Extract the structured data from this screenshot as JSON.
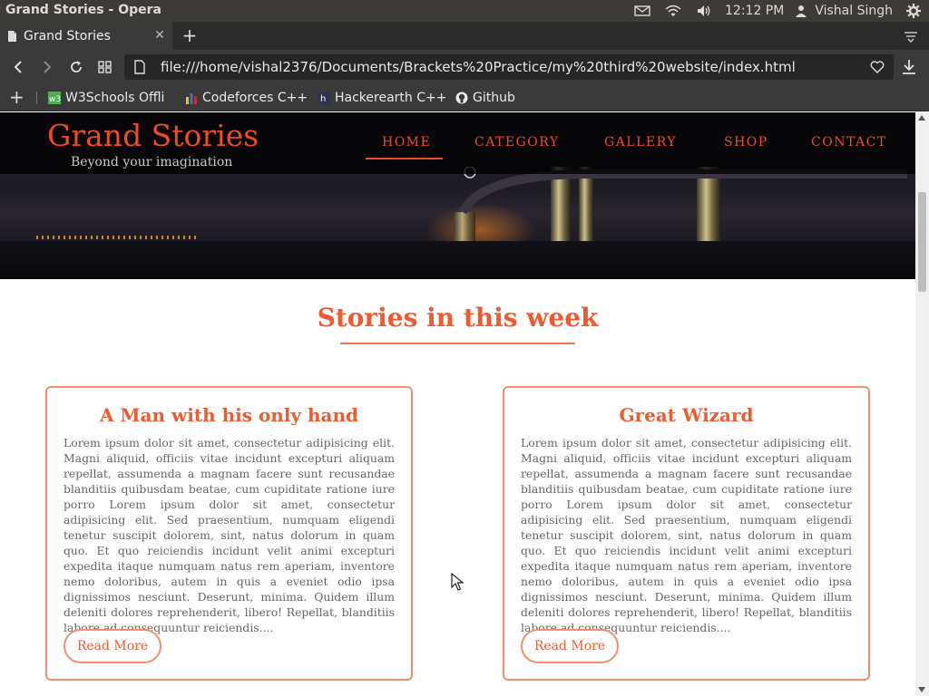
{
  "os": {
    "window_title": "Grand Stories - Opera",
    "time": "12:12 PM",
    "user": "Vishal Singh",
    "icons": [
      "mail-icon",
      "wifi-icon",
      "volume-icon",
      "user-icon",
      "settings-gear-icon"
    ]
  },
  "browser": {
    "tab_title": "Grand Stories",
    "url": "file:///home/vishal2376/Documents/Brackets%20Practice/my%20third%20website/index.html",
    "bookmarks": [
      {
        "label": "W3Schools Offli",
        "icon": "w3schools-icon"
      },
      {
        "label": "Codeforces C++",
        "icon": "codeforces-icon"
      },
      {
        "label": "Hackerearth C++",
        "icon": "hackerearth-icon"
      },
      {
        "label": "Github",
        "icon": "github-icon"
      }
    ]
  },
  "site": {
    "brand": "Grand Stories",
    "tagline": "Beyond your imagination",
    "nav": [
      "HOME",
      "CATEGORY",
      "GALLERY",
      "SHOP",
      "CONTACT"
    ],
    "active_nav": "HOME",
    "section_title": "Stories in this week",
    "accent_color": "#ef5a2e",
    "cards": [
      {
        "title": "A Man with his only hand",
        "body": "Lorem ipsum dolor sit amet, consectetur adipisicing elit. Magni aliquid, officiis vitae incidunt excepturi aliquam repellat, assumenda a magnam facere sunt recusandae blanditiis quibusdam beatae, cum cupiditate ratione iure porro Lorem ipsum dolor sit amet, consectetur adipisicing elit. Sed praesentium, numquam eligendi tenetur suscipit dolorem, sint, natus dolorum in quam quo. Et quo reiciendis incidunt velit animi excepturi expedita itaque numquam natus rem aperiam, inventore nemo doloribus, autem in quis a eveniet odio ipsa dignissimos nesciunt. Deserunt, minima. Quidem illum deleniti dolores reprehenderit, libero! Repellat, blanditiis labore ad consequuntur reiciendis....",
        "button": "Read More"
      },
      {
        "title": "Great Wizard",
        "body": "Lorem ipsum dolor sit amet, consectetur adipisicing elit. Magni aliquid, officiis vitae incidunt excepturi aliquam repellat, assumenda a magnam facere sunt recusandae blanditiis quibusdam beatae, cum cupiditate ratione iure porro Lorem ipsum dolor sit amet, consectetur adipisicing elit. Sed praesentium, numquam eligendi tenetur suscipit dolorem, sint, natus dolorum in quam quo. Et quo reiciendis incidunt velit animi excepturi expedita itaque numquam natus rem aperiam, inventore nemo doloribus, autem in quis a eveniet odio ipsa dignissimos nesciunt. Deserunt, minima. Quidem illum deleniti dolores reprehenderit, libero! Repellat, blanditiis labore ad consequuntur reiciendis....",
        "button": "Read More"
      }
    ]
  }
}
